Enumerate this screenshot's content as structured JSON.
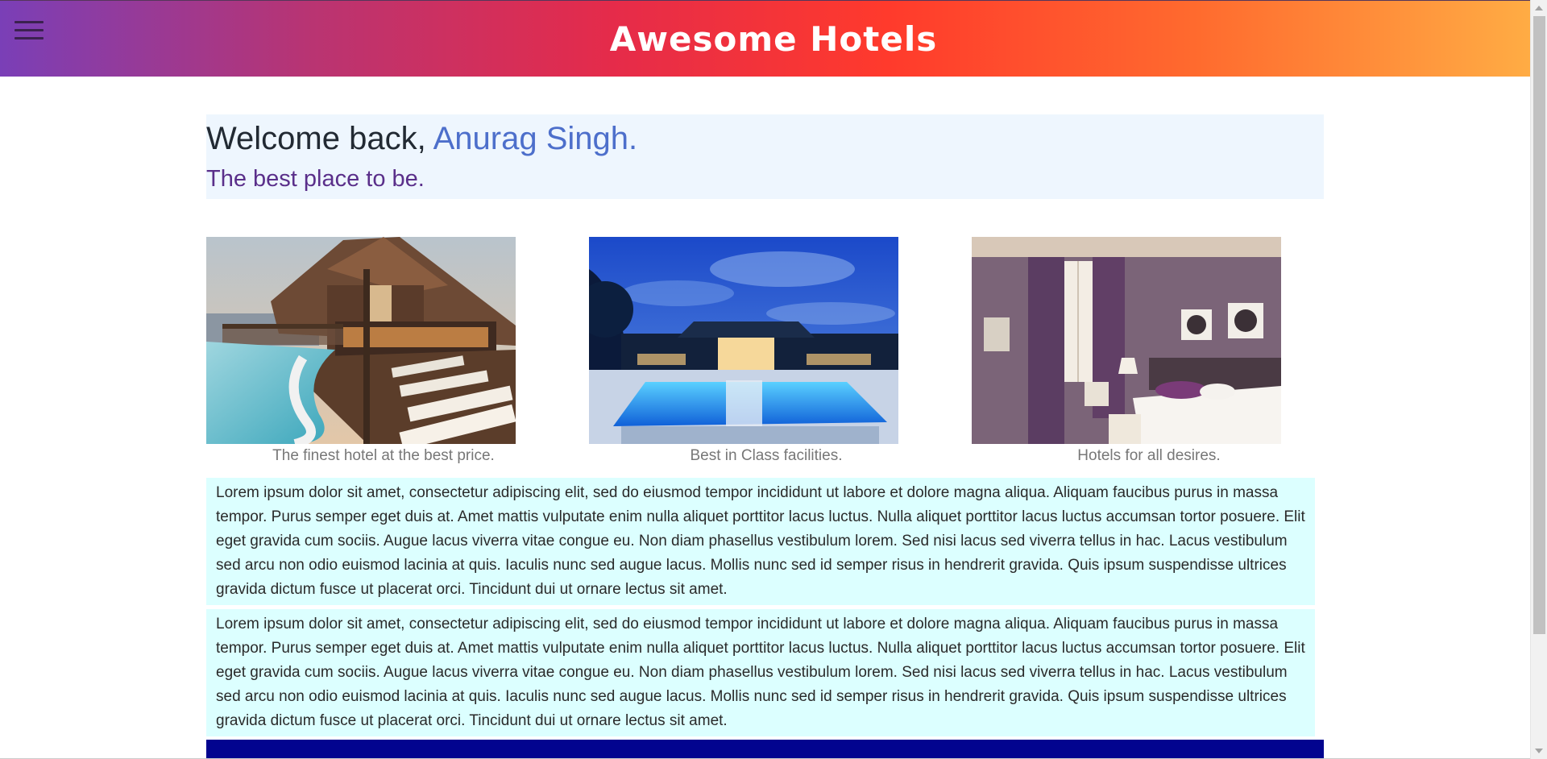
{
  "header": {
    "title": "Awesome Hotels",
    "menu_icon": "hamburger-menu-icon",
    "gradient": [
      "#7a3fb7",
      "#e52b4a",
      "#ff3a2c",
      "#ffac44"
    ]
  },
  "welcome": {
    "greeting": "Welcome back, ",
    "name": "Anurag Singh.",
    "tagline": "The best place to be."
  },
  "gallery": [
    {
      "image": "resort-pool-deck-photo",
      "caption": "The finest hotel at the best price."
    },
    {
      "image": "night-hotel-pool-photo",
      "caption": "Best in Class facilities."
    },
    {
      "image": "hotel-bedroom-photo",
      "caption": "Hotels for all desires."
    }
  ],
  "paragraphs": [
    "Lorem ipsum dolor sit amet, consectetur adipiscing elit, sed do eiusmod tempor incididunt ut labore et dolore magna aliqua. Aliquam faucibus purus in massa tempor. Purus semper eget duis at. Amet mattis vulputate enim nulla aliquet porttitor lacus luctus. Nulla aliquet porttitor lacus luctus accumsan tortor posuere. Elit eget gravida cum sociis. Augue lacus viverra vitae congue eu. Non diam phasellus vestibulum lorem. Sed nisi lacus sed viverra tellus in hac. Lacus vestibulum sed arcu non odio euismod lacinia at quis. Iaculis nunc sed augue lacus. Mollis nunc sed id semper risus in hendrerit gravida. Quis ipsum suspendisse ultrices gravida dictum fusce ut placerat orci. Tincidunt dui ut ornare lectus sit amet.",
    "Lorem ipsum dolor sit amet, consectetur adipiscing elit, sed do eiusmod tempor incididunt ut labore et dolore magna aliqua. Aliquam faucibus purus in massa tempor. Purus semper eget duis at. Amet mattis vulputate enim nulla aliquet porttitor lacus luctus. Nulla aliquet porttitor lacus luctus accumsan tortor posuere. Elit eget gravida cum sociis. Augue lacus viverra vitae congue eu. Non diam phasellus vestibulum lorem. Sed nisi lacus sed viverra tellus in hac. Lacus vestibulum sed arcu non odio euismod lacinia at quis. Iaculis nunc sed augue lacus. Mollis nunc sed id semper risus in hendrerit gravida. Quis ipsum suspendisse ultrices gravida dictum fusce ut placerat orci. Tincidunt dui ut ornare lectus sit amet."
  ],
  "colors": {
    "welcome_bg": "#eef6fe",
    "name": "#4d6fcb",
    "tagline": "#5a2f8a",
    "paragraph_bg": "#dcffff",
    "footer_bar": "#02048f"
  }
}
